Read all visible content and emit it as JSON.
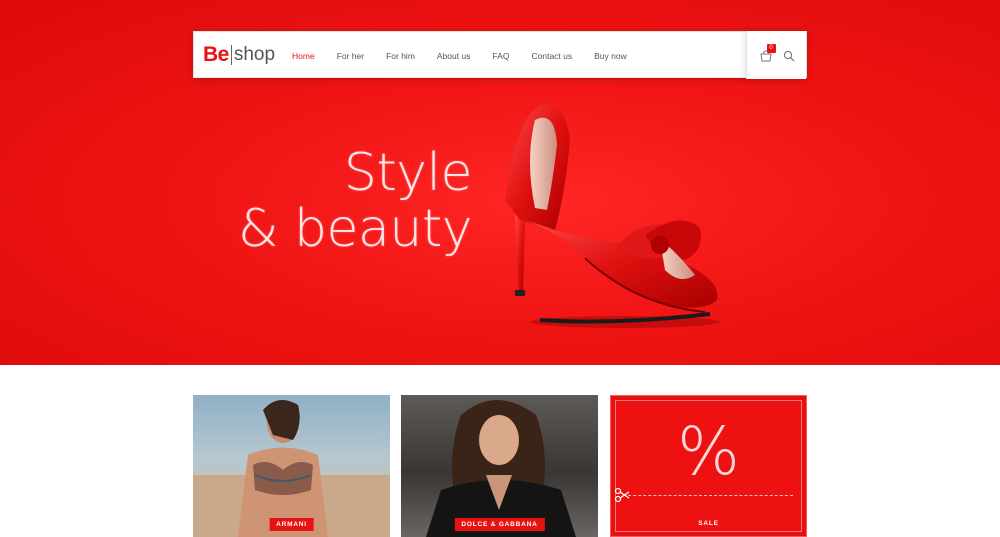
{
  "logo": {
    "be": "Be",
    "shop": "shop"
  },
  "nav": [
    {
      "label": "Home",
      "active": true
    },
    {
      "label": "For her",
      "active": false
    },
    {
      "label": "For him",
      "active": false
    },
    {
      "label": "About us",
      "active": false
    },
    {
      "label": "FAQ",
      "active": false
    },
    {
      "label": "Contact us",
      "active": false
    },
    {
      "label": "Buy now",
      "active": false
    }
  ],
  "cart": {
    "count": "0"
  },
  "icons": {
    "cart": "shopping-bag-icon",
    "search": "search-icon",
    "scissors": "scissors-icon"
  },
  "hero": {
    "line1": "Style",
    "line2": "& beauty"
  },
  "tiles": [
    {
      "label": "ARMANI"
    },
    {
      "label": "DOLCE & GABBANA"
    },
    {
      "symbol": "%",
      "label": "SALE"
    }
  ],
  "colors": {
    "accent": "#e81212",
    "hero_bg": "#ee1111"
  }
}
